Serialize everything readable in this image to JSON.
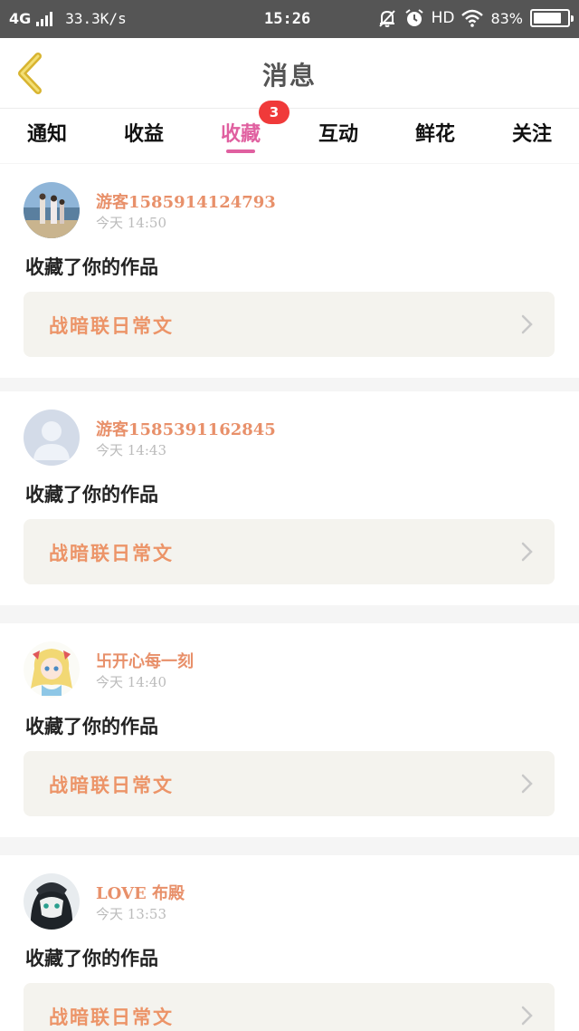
{
  "status_bar": {
    "network": "4G",
    "speed": "33.3K/s",
    "time": "15:26",
    "hd": "HD",
    "battery_pct": "83%",
    "battery_level": 0.83
  },
  "header": {
    "title": "消息",
    "back_icon": "back-chevron-icon"
  },
  "tabs": [
    {
      "label": "通知"
    },
    {
      "label": "收益"
    },
    {
      "label": "收藏",
      "badge": "3",
      "active": true
    },
    {
      "label": "互动"
    },
    {
      "label": "鲜花"
    },
    {
      "label": "关注"
    }
  ],
  "feed": [
    {
      "username": "游客1585914124793",
      "time": "今天 14:50",
      "action": "收藏了你的作品",
      "work": "战暗联日常文",
      "avatar": "photo"
    },
    {
      "username": "游客1585391162845",
      "time": "今天 14:43",
      "action": "收藏了你的作品",
      "work": "战暗联日常文",
      "avatar": "default-user"
    },
    {
      "username": "卐开心每一刻",
      "time": "今天 14:40",
      "action": "收藏了你的作品",
      "work": "战暗联日常文",
      "avatar": "anime-girl"
    },
    {
      "username": "LOVE 布殿",
      "time": "今天 13:53",
      "action": "收藏了你的作品",
      "work": "战暗联日常文",
      "avatar": "anime-dark"
    }
  ],
  "colors": {
    "accent": "#e060a0",
    "username": "#e8906a",
    "work_title": "#ec9468",
    "badge": "#f03a3a",
    "back_icon": "#d8b430"
  }
}
